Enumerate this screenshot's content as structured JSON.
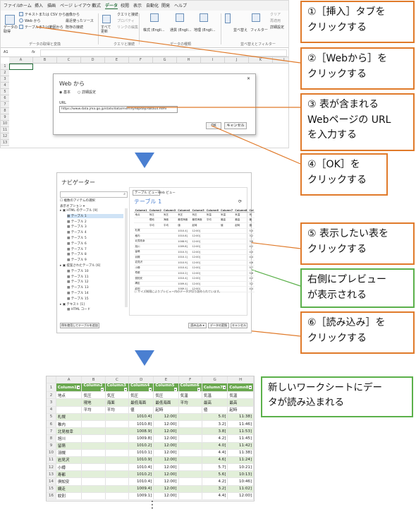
{
  "excel": {
    "tabs": [
      "ファイル",
      "ホーム",
      "挿入",
      "描画",
      "ページ レイアウト",
      "数式",
      "データ",
      "校閲",
      "表示",
      "自動化",
      "開発",
      "ヘルプ"
    ],
    "active_tab": "データ",
    "ribbon": {
      "get_data": "データの\n取得",
      "from_text_csv": "テキストまたは CSV から",
      "from_web": "Web から",
      "from_table": "テーブルまたは範囲から",
      "recent_sources": "最近使ったソース",
      "images": "画像から",
      "existing_connections": "既存の接続",
      "refresh_all": "すべて\n更新",
      "queries_connections": "クエリと接続",
      "properties": "プロパティ",
      "edit_links": "リンクの編集",
      "stocks": "株式 (Engli...",
      "currency": "通貨 (Engli...",
      "geography": "地理 (Engli...",
      "sort": "並べ替え",
      "filter": "フィルター",
      "clear": "クリア",
      "reapply": "再適用",
      "advanced": "詳細設定",
      "group_get": "データの取得と変換",
      "group_queries": "クエリと接続",
      "group_types": "データの種類",
      "group_sort": "並べ替えとフィルター"
    },
    "name_box": "A1",
    "fx": "fx",
    "columns": [
      "A",
      "B",
      "C",
      "D",
      "E",
      "F",
      "G",
      "H",
      "I",
      "J",
      "K",
      "L"
    ],
    "rows": [
      "1",
      "2",
      "3",
      "4",
      "5",
      "6",
      "7",
      "8",
      "9",
      "10",
      "11",
      "12",
      "13"
    ],
    "dialog": {
      "title": "Web から",
      "radio_basic": "基本",
      "radio_advanced": "詳細設定",
      "url_label": "URL",
      "url_value": "https://www.data.jma.go.jp/stats/data/mdrr/synopday/data1s.html",
      "ok": "OK",
      "cancel": "キャンセル"
    }
  },
  "callouts": [
    {
      "lines": [
        "①［挿入］タブを",
        "クリックする"
      ]
    },
    {
      "lines": [
        "②［Webから］を",
        "クリックする"
      ]
    },
    {
      "lines": [
        "③ 表が含まれる",
        "Webページの URL",
        "を入力する"
      ]
    },
    {
      "lines": [
        "④［OK］を",
        "クリックする"
      ]
    },
    {
      "lines": [
        "⑤ 表示したい表を",
        "クリックする"
      ]
    },
    {
      "lines": [
        "右側にプレビュー",
        "が表示される"
      ]
    },
    {
      "lines": [
        "⑥［読み込み］を",
        "クリックする"
      ]
    },
    {
      "lines": [
        "新しいワークシートにデー",
        "タが読み込まれる"
      ]
    }
  ],
  "navigator": {
    "title": "ナビゲーター",
    "search_placeholder": "",
    "select_multiple": "複数のアイテムの選択",
    "display_options": "表示オプション",
    "html_tables": "HTML のテーブル [9]",
    "tables": [
      "テーブル 1",
      "テーブル 2",
      "テーブル 3",
      "テーブル 4",
      "テーブル 5",
      "テーブル 6",
      "テーブル 7",
      "テーブル 8",
      "テーブル 9"
    ],
    "suggested_tables": "提案されたテーブル [6]",
    "suggested": [
      "テーブル 10",
      "テーブル 11",
      "テーブル 12",
      "テーブル 13",
      "テーブル 14",
      "テーブル 15"
    ],
    "text_group": "テキスト [1]",
    "html_code": "HTML コード",
    "tab_table_view": "テーブル ビュー",
    "tab_web_view": "Web ビュー",
    "preview_title": "テーブル 1",
    "preview_headers": [
      "Column1",
      "Column2",
      "Column3",
      "Column4",
      "Column5",
      "Column6",
      "Column7",
      "Column8",
      "Col"
    ],
    "preview_rows": [
      [
        "地点",
        "気圧",
        "気圧",
        "気圧",
        "気圧",
        "気温",
        "気温",
        "気温",
        "気"
      ],
      [
        "",
        "現地",
        "海面",
        "最低海面",
        "最低海面",
        "平均",
        "最高",
        "最高",
        "最"
      ],
      [
        "",
        "平均",
        "平均",
        "値",
        "起時",
        "",
        "値",
        "起時",
        "値"
      ],
      [
        "札幌",
        "",
        "",
        "1010.4]",
        "12:00]",
        "",
        "",
        "",
        "5.0"
      ],
      [
        "稚内",
        "",
        "",
        "1010.8]",
        "12:00]",
        "",
        "",
        "",
        "3.2"
      ],
      [
        "北見枝幸",
        "",
        "",
        "1008.9]",
        "12:00]",
        "",
        "",
        "",
        "3.8"
      ],
      [
        "旭川",
        "",
        "",
        "1009.8]",
        "12:00]",
        "",
        "",
        "",
        "4.2"
      ],
      [
        "留萌",
        "",
        "",
        "1010.3]",
        "12:00]",
        "",
        "",
        "",
        "4.0"
      ],
      [
        "羽幌",
        "",
        "",
        "1010.1]",
        "12:00]",
        "",
        "",
        "",
        "4.4"
      ],
      [
        "岩見沢",
        "",
        "",
        "1010.9]",
        "12:00]",
        "",
        "",
        "",
        "4.6"
      ],
      [
        "小樽",
        "",
        "",
        "1010.4]",
        "12:00]",
        "",
        "",
        "",
        "5.7"
      ],
      [
        "寿都",
        "",
        "",
        "1010.2]",
        "12:00]",
        "",
        "",
        "",
        "5.6"
      ],
      [
        "俱知安",
        "",
        "",
        "1010.4]",
        "12:00]",
        "",
        "",
        "",
        "4.2"
      ],
      [
        "網走",
        "",
        "",
        "1009.4]",
        "12:00]",
        "",
        "",
        "",
        "3.2"
      ],
      [
        "紋別",
        "",
        "",
        "1009.1]",
        "12:00]",
        "",
        "",
        "",
        "4.4"
      ]
    ],
    "footnote": "サイズ制限によりプレビュー内のデータが切り詰められています。",
    "add_table_button": "例を使用してテーブルを追加",
    "load": "読み込み",
    "transform": "データの変換",
    "cancel": "キャンセル"
  },
  "result": {
    "columns": [
      "A",
      "B",
      "C",
      "D",
      "E",
      "F",
      "G",
      "H"
    ],
    "headers": [
      "Column1",
      "Column2",
      "Column3",
      "Column4",
      "Column5",
      "Column6",
      "Column7",
      "Column8"
    ],
    "rows": [
      [
        "地点",
        "気圧",
        "気圧",
        "気圧",
        "気圧",
        "気温",
        "気温",
        "気温"
      ],
      [
        "",
        "現地",
        "海面",
        "最低海面",
        "最低海面",
        "平均",
        "最高",
        "最高"
      ],
      [
        "",
        "平均",
        "平均",
        "値",
        "起時",
        "",
        "値",
        "起時"
      ],
      [
        "札幌",
        "",
        "",
        "1010.4]",
        "12:00]",
        "",
        "5.0]",
        "11:38]"
      ],
      [
        "稚内",
        "",
        "",
        "1010.8]",
        "12:00]",
        "",
        "3.2]",
        "11:46]"
      ],
      [
        "北見枝幸",
        "",
        "",
        "1008.9]",
        "12:00]",
        "",
        "3.8]",
        "11:53]"
      ],
      [
        "旭川",
        "",
        "",
        "1009.8]",
        "12:00]",
        "",
        "4.2]",
        "11:45]"
      ],
      [
        "留萌",
        "",
        "",
        "1010.2]",
        "12:00]",
        "",
        "4.0]",
        "11:42]"
      ],
      [
        "羽幌",
        "",
        "",
        "1010.1]",
        "12:00]",
        "",
        "4.4]",
        "11:38]"
      ],
      [
        "岩見沢",
        "",
        "",
        "1010.9]",
        "12:00]",
        "",
        "4.6]",
        "11:24]"
      ],
      [
        "小樽",
        "",
        "",
        "1010.4]",
        "12:00]",
        "",
        "5.7]",
        "10:21]"
      ],
      [
        "寿都",
        "",
        "",
        "1010.2]",
        "12:00]",
        "",
        "5.6]",
        "10:13]"
      ],
      [
        "俱知安",
        "",
        "",
        "1010.4]",
        "12:00]",
        "",
        "4.2]",
        "10:46]"
      ],
      [
        "網走",
        "",
        "",
        "1009.4]",
        "12:00]",
        "",
        "3.2]",
        "11:02]"
      ],
      [
        "紋別",
        "",
        "",
        "1009.1]",
        "12:00]",
        "",
        "4.4]",
        "12:00]"
      ]
    ],
    "ellipsis": "⋮"
  },
  "colors": {
    "accent_orange": "#e07a2a",
    "accent_green": "#5bb04a",
    "arrow_blue": "#4a7fd1",
    "table_green": "#6aa84f"
  }
}
